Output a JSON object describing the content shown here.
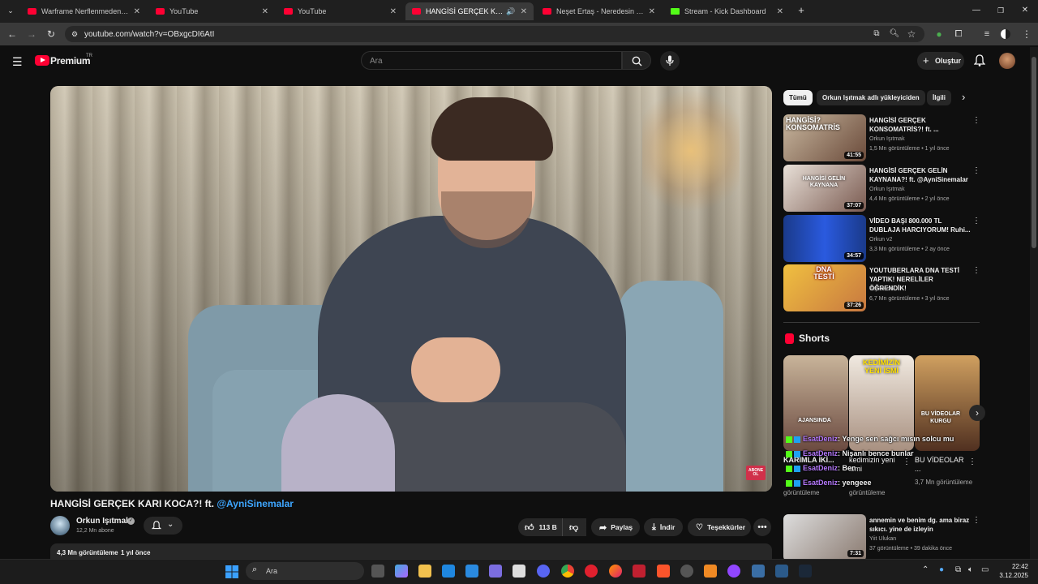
{
  "browser": {
    "tabs": [
      {
        "title": "Warframe Nerflenmeden Ö",
        "kind": "yt"
      },
      {
        "title": "YouTube",
        "kind": "yt"
      },
      {
        "title": "YouTube",
        "kind": "yt"
      },
      {
        "title": "HANGİSİ GERÇEK KARI KO",
        "kind": "yt"
      },
      {
        "title": "Neşet Ertaş - Neredesin Sen (A",
        "kind": "yt"
      },
      {
        "title": "Stream - Kick Dashboard",
        "kind": "kick"
      }
    ],
    "url": "youtube.com/watch?v=OBxgcDI6AtI"
  },
  "masthead": {
    "logo_text": "Premium",
    "region": "TR",
    "search_placeholder": "Ara",
    "create_label": "Oluştur"
  },
  "video": {
    "title_main": "HANGİSİ GERÇEK KARI KOCA?! ft.",
    "title_mention": "@AyniSinemalar",
    "channel": "Orkun Işıtmak",
    "subscribers": "12,2 Mn abone",
    "likes": "113 B",
    "share_label": "Paylaş",
    "download_label": "İndir",
    "thanks_label": "Teşekkürler",
    "views": "4,3 Mn görüntüleme",
    "age": "1 yıl önce",
    "watermark_text": "ABONE OL"
  },
  "chips": [
    "Tümü",
    "Orkun Işıtmak adlı yükleyiciden",
    "İlgili"
  ],
  "recommended": [
    {
      "title": "HANGİSİ GERÇEK KONSOMATRİS?! ft. ...",
      "channel": "Orkun Işıtmak",
      "meta": "1,5 Mn görüntüleme • 1 yıl önce",
      "duration": "41:55",
      "thumb_text": "HANGİSİ? KONSOMATRİS"
    },
    {
      "title": "HANGİSİ GERÇEK GELİN KAYNANA?! ft. @AyniSinemalar",
      "channel": "Orkun Işıtmak",
      "meta": "4,4 Mn görüntüleme • 2 yıl önce",
      "duration": "37:07",
      "thumb_text": "HANGİSİ GELİN KAYNANA"
    },
    {
      "title": "VİDEO BAŞI 800.000 TL DUBLAJA HARCIYORUM! Ruhi...",
      "channel": "Orkun v2",
      "meta": "3,3 Mn görüntüleme • 2 ay önce",
      "duration": "34:57",
      "thumb_text": ""
    },
    {
      "title": "YOUTUBERLARA DNA TESTİ YAPTIK! NERELİLER ÖĞRENDİK!",
      "channel": "TepkiKolik",
      "meta": "6,7 Mn görüntüleme • 3 yıl önce",
      "duration": "37:26",
      "thumb_text": "DNA TESTİ"
    }
  ],
  "shorts": {
    "heading": "Shorts",
    "items": [
      {
        "title": "KARIMLA İKİ...",
        "meta": "görüntüleme",
        "overlay": "AJANSINDA"
      },
      {
        "title": "kedimizin yeni ismi",
        "meta": "görüntüleme",
        "overlay": "KEDİMİZİN YENİ İSMİ"
      },
      {
        "title": "BU VİDEOLAR ...",
        "meta": "3,7 Mn görüntüleme",
        "overlay": "BU VİDEOLAR KURGU"
      }
    ]
  },
  "chat_overlay": [
    {
      "user": "EsatDeniz",
      "text": ": Yenge sen sağcı mısın solcu mu"
    },
    {
      "user": "EsatDeniz",
      "text": ": Nişanlı bence bunlar"
    },
    {
      "user": "EsatDeniz",
      "text": ": Ben"
    },
    {
      "user": "EsatDeniz",
      "text": ": yengeee"
    }
  ],
  "recommended_bottom": {
    "title": "annemin ve benim dg. ama biraz sıkıcı. yine de izleyin",
    "channel": "Yiit Ulukan",
    "meta": "37 görüntüleme • 39 dakika önce",
    "duration": "7:31"
  },
  "taskbar": {
    "search_label": "Ara",
    "time": "22:42",
    "date": "3.12.2025"
  },
  "colors": {
    "youtube_red": "#ff0033",
    "kick_green": "#53fc18",
    "link_blue": "#3ea6ff",
    "chat_user": "#b77aff"
  }
}
